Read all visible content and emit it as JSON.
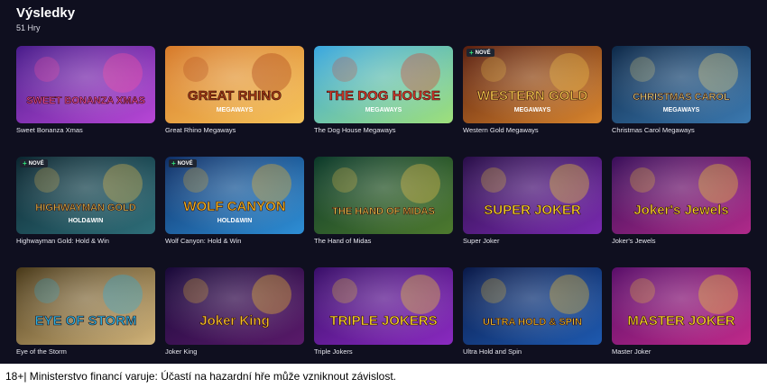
{
  "results": {
    "title": "Výsledky",
    "count_label": "51 Hry"
  },
  "new_badge_label": "NOVÉ",
  "games": [
    {
      "name": "Sweet Bonanza Xmas",
      "art": "SWEET BONANZA XMAS",
      "is_new": false,
      "colors": [
        "#4a1d8c",
        "#b847d6"
      ],
      "accent": "#ff4fa0"
    },
    {
      "name": "Great Rhino Megaways",
      "art": "GREAT RHINO",
      "art_sub": "MEGAWAYS",
      "is_new": false,
      "colors": [
        "#d77a2a",
        "#f6c45a"
      ],
      "accent": "#a63a12"
    },
    {
      "name": "The Dog House Megaways",
      "art": "THE DOG HOUSE",
      "art_sub": "MEGAWAYS",
      "is_new": false,
      "colors": [
        "#3aa7e0",
        "#9fe07a"
      ],
      "accent": "#d93a2a"
    },
    {
      "name": "Western Gold Megaways",
      "art": "WESTERN GOLD",
      "art_sub": "MEGAWAYS",
      "is_new": true,
      "colors": [
        "#5a1f0f",
        "#d9862e"
      ],
      "accent": "#f0c24a"
    },
    {
      "name": "Christmas Carol Megaways",
      "art": "CHRISTMAS CAROL",
      "art_sub": "MEGAWAYS",
      "is_new": false,
      "colors": [
        "#0e2a4a",
        "#3b79b0"
      ],
      "accent": "#e8d27a"
    },
    {
      "name": "Highwayman Gold: Hold & Win",
      "art": "HIGHWAYMAN GOLD",
      "art_sub": "HOLD&WIN",
      "is_new": true,
      "colors": [
        "#0b2630",
        "#2f6f7a"
      ],
      "accent": "#e6b94a"
    },
    {
      "name": "Wolf Canyon: Hold & Win",
      "art": "WOLF CANYON",
      "art_sub": "HOLD&WIN",
      "is_new": true,
      "colors": [
        "#0f2f66",
        "#2e8fd6"
      ],
      "accent": "#f5b51f"
    },
    {
      "name": "The Hand of Midas",
      "art": "THE HAND OF MIDAS",
      "is_new": false,
      "colors": [
        "#0c3a2a",
        "#4e7a2e"
      ],
      "accent": "#f2c24a"
    },
    {
      "name": "Super Joker",
      "art": "SUPER JOKER",
      "is_new": false,
      "colors": [
        "#2a0f4a",
        "#7a2ab0"
      ],
      "accent": "#f5d02a"
    },
    {
      "name": "Joker's Jewels",
      "art": "Joker's Jewels",
      "is_new": false,
      "colors": [
        "#3a0f5a",
        "#b02a8a"
      ],
      "accent": "#f5d02a"
    },
    {
      "name": "Eye of the Storm",
      "art": "EYE OF STORM",
      "is_new": false,
      "colors": [
        "#4a3a1a",
        "#d2b47a"
      ],
      "accent": "#2ab0e0"
    },
    {
      "name": "Joker King",
      "art": "Joker King",
      "is_new": false,
      "colors": [
        "#1a0a3a",
        "#5a1a6a"
      ],
      "accent": "#f5c02a"
    },
    {
      "name": "Triple Jokers",
      "art": "TRIPLE JOKERS",
      "is_new": false,
      "colors": [
        "#3a0f6a",
        "#8a2ac0"
      ],
      "accent": "#f5d02a"
    },
    {
      "name": "Ultra Hold and Spin",
      "art": "ULTRA HOLD & SPIN",
      "is_new": false,
      "colors": [
        "#0a1a4a",
        "#1e5ab0"
      ],
      "accent": "#f5c02a"
    },
    {
      "name": "Master Joker",
      "art": "MASTER JOKER",
      "is_new": false,
      "colors": [
        "#5a0f6a",
        "#c02a8a"
      ],
      "accent": "#f5d02a"
    }
  ],
  "footer": {
    "warning": "18+| Ministerstvo financí varuje: Účastí na hazardní hře může vzniknout závislost."
  }
}
